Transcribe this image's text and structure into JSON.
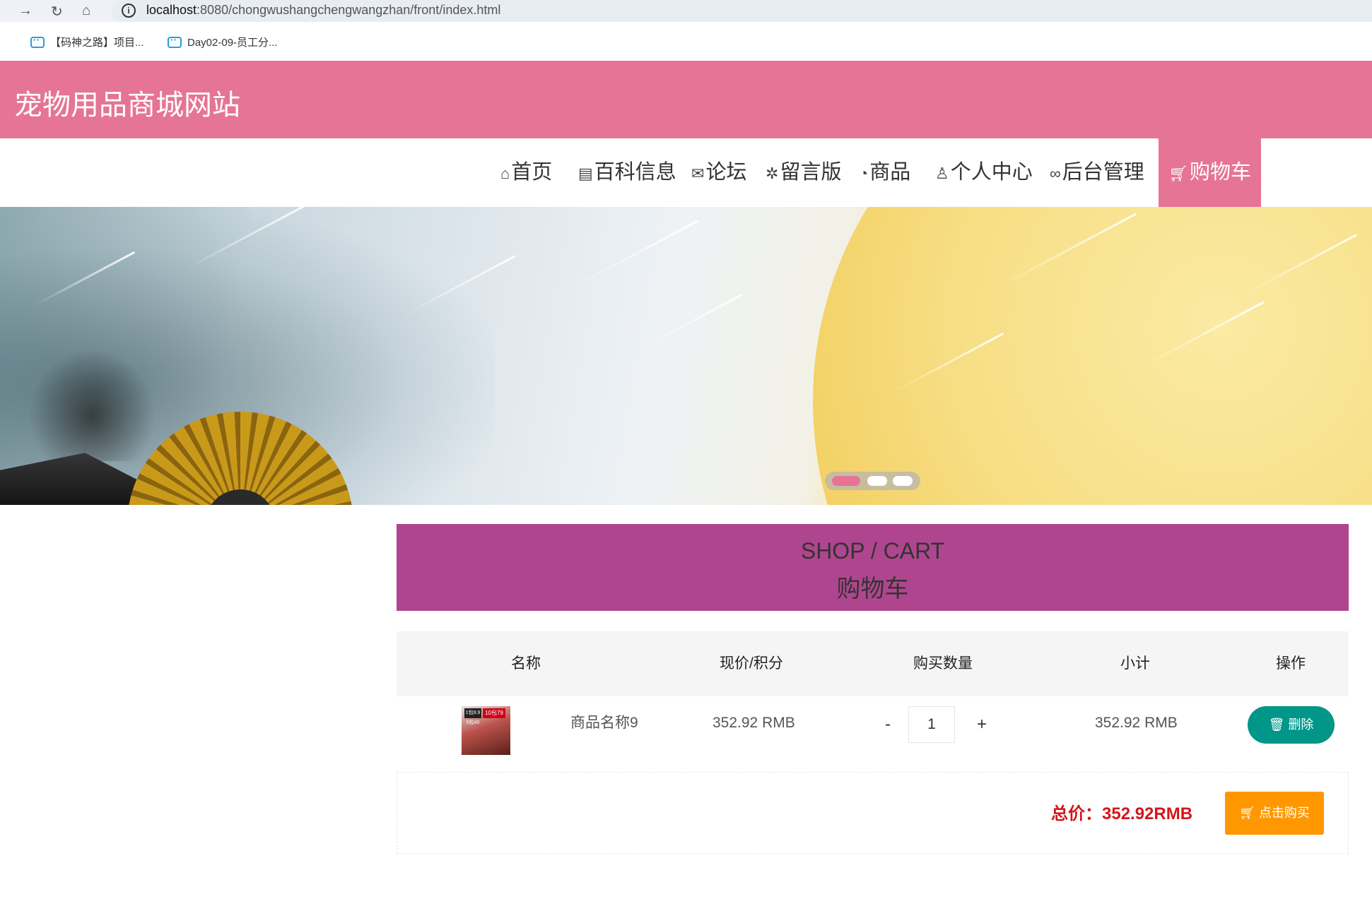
{
  "browser": {
    "url_host": "localhost",
    "url_rest": ":8080/chongwushangchengwangzhan/front/index.html",
    "bookmarks": [
      "【码神之路】项目...",
      "Day02-09-员工分..."
    ]
  },
  "site": {
    "title": "宠物用品商城网站"
  },
  "nav": {
    "items": [
      {
        "label": "首页",
        "icon": "home-icon"
      },
      {
        "label": "百科信息",
        "icon": "clipboard-icon"
      },
      {
        "label": "论坛",
        "icon": "mail-icon"
      },
      {
        "label": "留言版",
        "icon": "chat-icon"
      },
      {
        "label": "商品",
        "icon": "palette-icon"
      },
      {
        "label": "个人中心",
        "icon": "user-icon"
      },
      {
        "label": "后台管理",
        "icon": "link-icon"
      },
      {
        "label": "购物车",
        "icon": "cart-icon",
        "active": true
      }
    ]
  },
  "banner": {
    "slides": 3,
    "active_slide": 1
  },
  "cart": {
    "title_en": "SHOP / CART",
    "title_zh": "购物车",
    "columns": [
      "名称",
      "现价/积分",
      "购买数量",
      "小计",
      "操作"
    ],
    "rows": [
      {
        "name": "商品名称9",
        "price": "352.92 RMB",
        "qty": "1",
        "subtotal": "352.92 RMB",
        "thumb_tag1": "1包9.9 5包40",
        "thumb_tag2": "10包79"
      }
    ],
    "minus_label": "-",
    "plus_label": "+",
    "delete_label": "删除",
    "total_label": "总价：352.92RMB",
    "buy_label": "点击购买"
  },
  "colors": {
    "header": "#e57496",
    "cart_head": "#b0458f",
    "delete": "#009688",
    "buy": "#ff9800",
    "total": "#d4161c"
  }
}
